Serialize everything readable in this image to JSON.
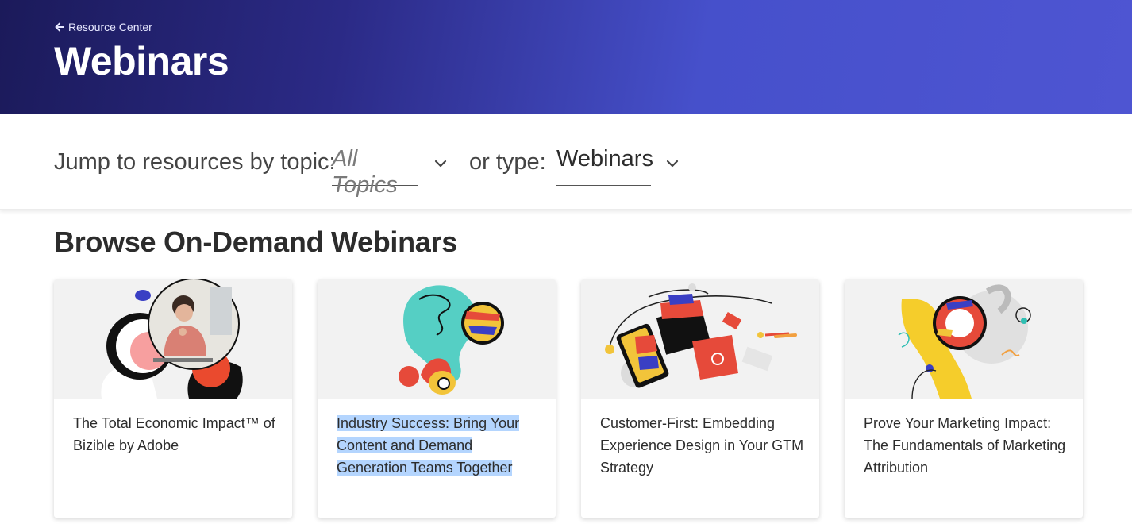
{
  "header": {
    "back_link": "Resource Center",
    "title": "Webinars"
  },
  "filters": {
    "topic_prompt": "Jump to resources by topic:",
    "topic_value": "All Topics",
    "type_prompt": "or type:",
    "type_value": "Webinars"
  },
  "section": {
    "title": "Browse On-Demand Webinars"
  },
  "cards": [
    {
      "title": "The Total Economic Impact™ of Bizible by Adobe",
      "image_icon": "woman-portrait-collage"
    },
    {
      "title": "Industry Success: Bring Your Content and Demand Generation Teams Together",
      "image_icon": "abstract-shapes-teal"
    },
    {
      "title": "Customer-First: Embedding Experience Design in Your GTM Strategy",
      "image_icon": "phone-tablet-collage"
    },
    {
      "title": "Prove Your Marketing Impact: The Fundamentals of Marketing Attribution",
      "image_icon": "abstract-shapes-yellow"
    }
  ],
  "colors": {
    "hero_start": "#1b1a5a",
    "hero_end": "#4e55d2",
    "highlight": "#b4d5fe"
  }
}
